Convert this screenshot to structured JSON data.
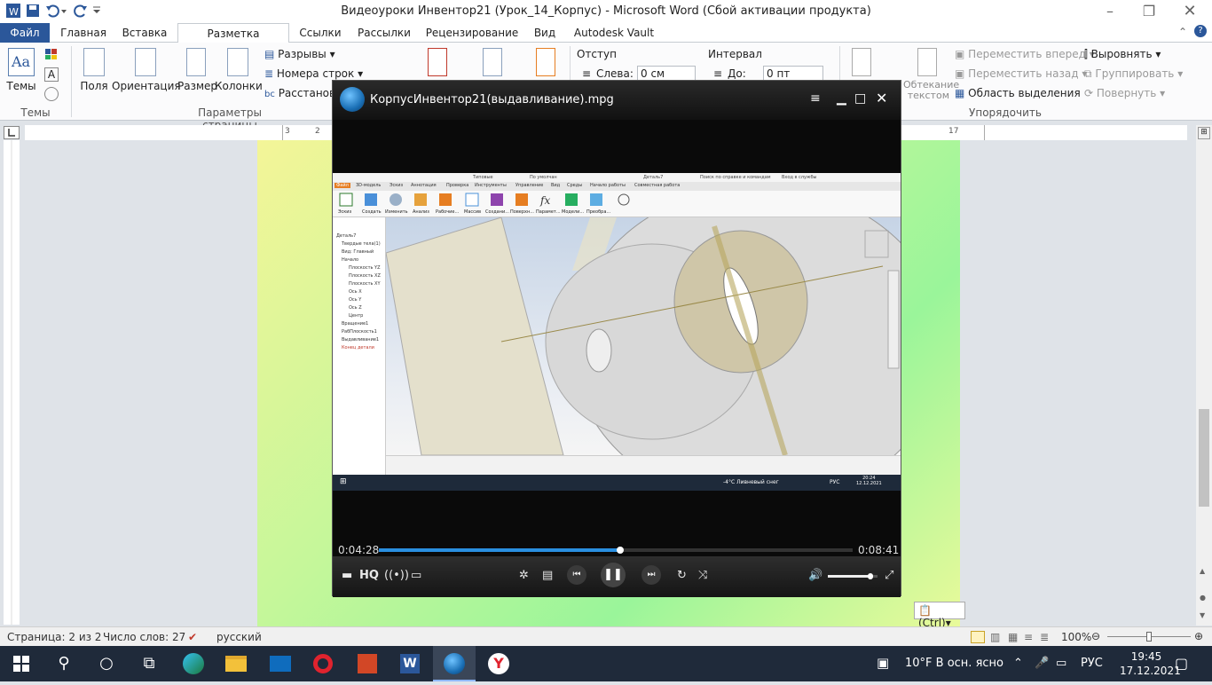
{
  "window": {
    "title": "Видеоуроки Инвентор21 (Урок_14_Корпус)  -  Microsoft Word (Сбой активации продукта)"
  },
  "tabs": [
    "Файл",
    "Главная",
    "Вставка",
    "Разметка страницы",
    "Ссылки",
    "Рассылки",
    "Рецензирование",
    "Вид",
    "Autodesk Vault"
  ],
  "ribbon": {
    "themes_label": "Темы",
    "themes_group": "Темы",
    "fields_label": "Поля",
    "orientation_label": "Ориентация",
    "size_label": "Размер",
    "columns_label": "Колонки",
    "breaks_label": "Разрывы",
    "line_numbers_label": "Номера строк",
    "hyphenation_label": "Расстанов",
    "page_setup_group": "Параметры страницы",
    "indent_label": "Отступ",
    "indent_left_label": "Слева:",
    "indent_left_value": "0 см",
    "spacing_label": "Интервал",
    "spacing_before_label": "До:",
    "spacing_before_value": "0 пт",
    "wrap_label": "Обтекание текстом",
    "bring_forward": "Переместить вперед",
    "send_backward": "Переместить назад",
    "selection_pane": "Область выделения",
    "align": "Выровнять",
    "group": "Группировать",
    "rotate": "Повернуть",
    "arrange_group": "Упорядочить"
  },
  "ruler": {
    "left_mark": "3",
    "mark2": "2",
    "mark_right": "17"
  },
  "player": {
    "title": "КорпусИнвентор21(выдавливание).mpg",
    "time_current": "0:04:28",
    "time_total": "0:08:41",
    "progress": 0.51,
    "volume": 0.85,
    "hq_label": "HQ"
  },
  "inventor": {
    "part_title": "Деталь7",
    "search_text": "Поиск по справке и командам",
    "login_text": "Вход в службы",
    "preset": "Типовые",
    "material": "По умолчан",
    "tabs": [
      "Файл",
      "3D-модель",
      "Эскиз",
      "Аннотация",
      "Проверка",
      "Инструменты",
      "Управление",
      "Вид",
      "Среды",
      "Начало работы",
      "Совместная работа"
    ],
    "tools": [
      "Эскиз",
      "Создать",
      "Изменить",
      "Анализ",
      "Рабочие...",
      "Массив",
      "Создани...",
      "Поверхн...",
      "Парамет...",
      "Модели...",
      "Преобра..."
    ],
    "tree": [
      "Деталь7",
      "Твердые тела(1)",
      "Вид: Главный",
      "Начало",
      "Плоскость YZ",
      "Плоскость XZ",
      "Плоскость XY",
      "Ось X",
      "Ось Y",
      "Ось Z",
      "Центр",
      "Вращение1",
      "РабПлоскость1",
      "Выдавливание1",
      "Конец детали"
    ],
    "taskbar_weather": "-4°C  Ливневый снег",
    "taskbar_lang": "РУС",
    "taskbar_time": "20:24",
    "taskbar_date": "12.12.2021"
  },
  "paste_badge": "(Ctrl)",
  "status": {
    "page": "Страница: 2 из 2",
    "words": "Число слов: 27",
    "language": "русский",
    "zoom": "100%"
  },
  "taskbar": {
    "weather": "10°F  В осн. ясно",
    "lang": "РУС",
    "time": "19:45",
    "date": "17.12.2021"
  }
}
